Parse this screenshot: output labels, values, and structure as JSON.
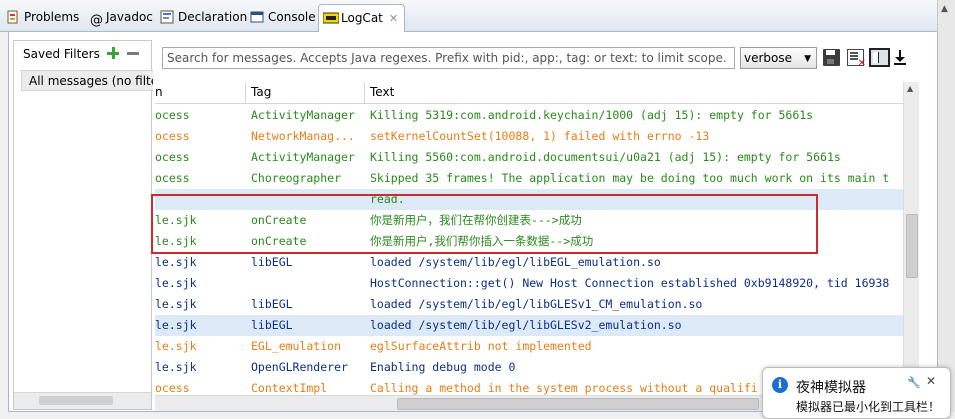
{
  "tabs": [
    {
      "label": "Problems",
      "icon": "problems-icon",
      "active": false
    },
    {
      "label": "Javadoc",
      "icon": "javadoc-icon",
      "active": false
    },
    {
      "label": "Declaration",
      "icon": "declaration-icon",
      "active": false
    },
    {
      "label": "Console",
      "icon": "console-icon",
      "active": false
    },
    {
      "label": "LogCat",
      "icon": "logcat-icon",
      "active": true
    }
  ],
  "tab_close": "✕",
  "filters": {
    "header": "Saved Filters",
    "items": [
      "All messages (no filters)"
    ]
  },
  "toolbar": {
    "search_placeholder": "Search for messages. Accepts Java regexes. Prefix with pid:, app:, tag: or text: to limit scope.",
    "level_value": "verbose"
  },
  "log": {
    "columns": {
      "pid": "n",
      "tag": "Tag",
      "text": "Text"
    },
    "rows": [
      {
        "pid": "ocess",
        "tag": "ActivityManager",
        "text": "Killing 5319:com.android.keychain/1000 (adj 15): empty for 5661s",
        "level": "I"
      },
      {
        "pid": "ocess",
        "tag": "NetworkManag...",
        "text": "setKernelCountSet(10088, 1) failed with errno -13",
        "level": "W"
      },
      {
        "pid": "ocess",
        "tag": "ActivityManager",
        "text": "Killing 5560:com.android.documentsui/u0a21 (adj 15): empty for 5661s",
        "level": "I"
      },
      {
        "pid": "ocess",
        "tag": "Choreographer",
        "text": "Skipped 35 frames!  The application may be doing too much work on its main t",
        "level": "I"
      },
      {
        "pid": "",
        "tag": "",
        "text": "read.",
        "level": "I",
        "selected": true
      },
      {
        "pid": "le.sjk",
        "tag": "onCreate",
        "text": "你是新用户，我们在帮你创建表--->成功",
        "level": "I"
      },
      {
        "pid": "le.sjk",
        "tag": "onCreate",
        "text": "你是新用户,我们帮你插入一条数据-->成功",
        "level": "I"
      },
      {
        "pid": "le.sjk",
        "tag": "libEGL",
        "text": "loaded /system/lib/egl/libEGL_emulation.so",
        "level": "D"
      },
      {
        "pid": "le.sjk",
        "tag": "",
        "text": "HostConnection::get() New Host Connection established 0xb9148920, tid 16938",
        "level": "D"
      },
      {
        "pid": "le.sjk",
        "tag": "libEGL",
        "text": "loaded /system/lib/egl/libGLESv1_CM_emulation.so",
        "level": "D"
      },
      {
        "pid": "le.sjk",
        "tag": "libEGL",
        "text": "loaded /system/lib/egl/libGLESv2_emulation.so",
        "level": "D",
        "selected": true
      },
      {
        "pid": "le.sjk",
        "tag": "EGL_emulation",
        "text": "eglSurfaceAttrib not implemented",
        "level": "W"
      },
      {
        "pid": "le.sjk",
        "tag": "OpenGLRenderer",
        "text": "Enabling debug mode 0",
        "level": "D"
      },
      {
        "pid": "ocess",
        "tag": "ContextImpl",
        "text": "Calling a method in the system process without a qualifi",
        "level": "W"
      }
    ]
  },
  "notification": {
    "title": "夜神模拟器",
    "body": "模拟器已最小化到工具栏！"
  },
  "colors": {
    "info": "#2a8a1c",
    "warn": "#e67e16",
    "debug": "#0b2f8a",
    "highlight": "#d22a2a",
    "selection": "#dce9f7"
  }
}
